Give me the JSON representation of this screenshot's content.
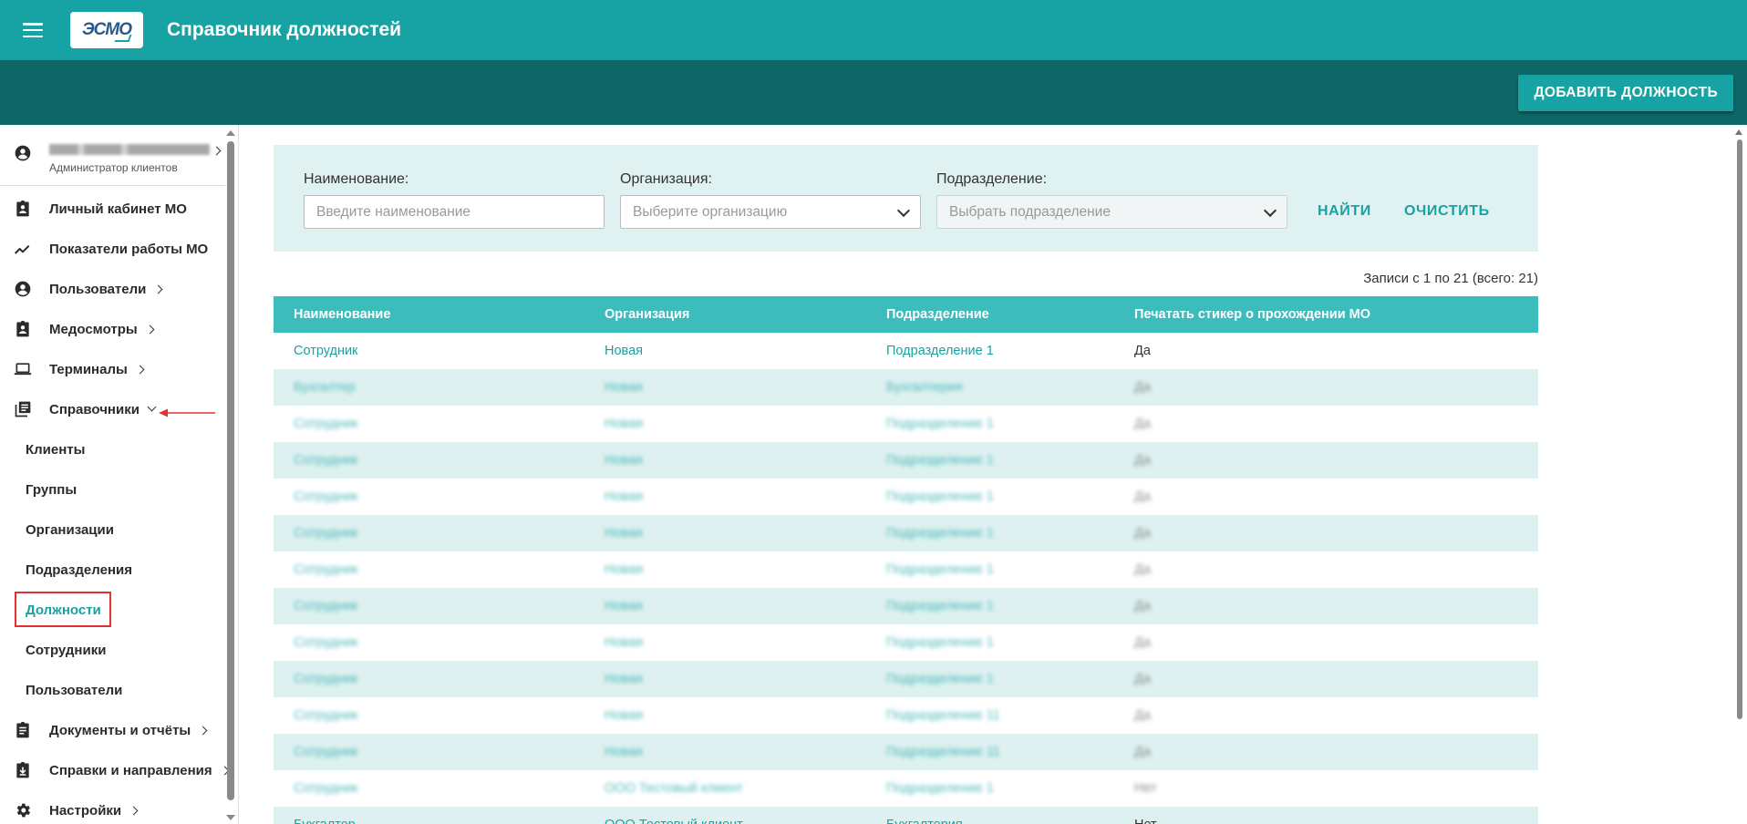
{
  "header": {
    "logo_text": "ЭСМО",
    "title": "Справочник должностей",
    "add_button": "ДОБАВИТЬ ДОЛЖНОСТЬ"
  },
  "sidebar": {
    "user": {
      "name": "Иванов Иван Иванович",
      "role": "Администратор клиентов"
    },
    "items": [
      {
        "label": "Личный кабинет МО",
        "icon": "clipboard-account-icon",
        "chevron": "none"
      },
      {
        "label": "Показатели работы МО",
        "icon": "trending-up-icon",
        "chevron": "none"
      },
      {
        "label": "Пользователи",
        "icon": "account-circle-icon",
        "chevron": "right"
      },
      {
        "label": "Медосмотры",
        "icon": "medical-clipboard-icon",
        "chevron": "right"
      },
      {
        "label": "Терминалы",
        "icon": "laptop-icon",
        "chevron": "right"
      },
      {
        "label": "Справочники",
        "icon": "library-books-icon",
        "chevron": "down"
      },
      {
        "label": "Документы и отчёты",
        "icon": "clipboard-text-icon",
        "chevron": "right"
      },
      {
        "label": "Справки и направления",
        "icon": "clipboard-download-icon",
        "chevron": "right"
      },
      {
        "label": "Настройки",
        "icon": "gear-icon",
        "chevron": "right"
      }
    ],
    "subitems": [
      {
        "label": "Клиенты"
      },
      {
        "label": "Группы"
      },
      {
        "label": "Организации"
      },
      {
        "label": "Подразделения"
      },
      {
        "label": "Должности",
        "active": true
      },
      {
        "label": "Сотрудники"
      },
      {
        "label": "Пользователи"
      }
    ],
    "accent_color": "#17a3a3",
    "highlight_color": "#e53030"
  },
  "filters": {
    "name_label": "Наименование:",
    "name_placeholder": "Введите наименование",
    "org_label": "Организация:",
    "org_placeholder": "Выберите организацию",
    "dept_label": "Подразделение:",
    "dept_placeholder": "Выбрать подразделение",
    "find_button": "НАЙТИ",
    "clear_button": "ОЧИСТИТЬ"
  },
  "records_info": "Записи с 1 по 21 (всего: 21)",
  "table": {
    "columns": [
      "Наименование",
      "Организация",
      "Подразделение",
      "Печатать стикер о прохождении МО"
    ],
    "rows": [
      {
        "name": "Сотрудник",
        "org": "Новая",
        "dept": "Подразделение 1",
        "print": "Да",
        "blurred": false
      },
      {
        "name": "Бухгалтер",
        "org": "Новая",
        "dept": "Бухгалтерия",
        "print": "Да",
        "blurred": true
      },
      {
        "name": "Сотрудник",
        "org": "Новая",
        "dept": "Подразделение 1",
        "print": "Да",
        "blurred": true
      },
      {
        "name": "Сотрудник",
        "org": "Новая",
        "dept": "Подразделение 1",
        "print": "Да",
        "blurred": true
      },
      {
        "name": "Сотрудник",
        "org": "Новая",
        "dept": "Подразделение 1",
        "print": "Да",
        "blurred": true
      },
      {
        "name": "Сотрудник",
        "org": "Новая",
        "dept": "Подразделение 1",
        "print": "Да",
        "blurred": true
      },
      {
        "name": "Сотрудник",
        "org": "Новая",
        "dept": "Подразделение 1",
        "print": "Да",
        "blurred": true
      },
      {
        "name": "Сотрудник",
        "org": "Новая",
        "dept": "Подразделение 1",
        "print": "Да",
        "blurred": true
      },
      {
        "name": "Сотрудник",
        "org": "Новая",
        "dept": "Подразделение 1",
        "print": "Да",
        "blurred": true
      },
      {
        "name": "Сотрудник",
        "org": "Новая",
        "dept": "Подразделение 1",
        "print": "Да",
        "blurred": true
      },
      {
        "name": "Сотрудник",
        "org": "Новая",
        "dept": "Подразделение 11",
        "print": "Да",
        "blurred": true
      },
      {
        "name": "Сотрудник",
        "org": "Новая",
        "dept": "Подразделение 11",
        "print": "Да",
        "blurred": true
      },
      {
        "name": "Сотрудник",
        "org": "ООО Тестовый клиент",
        "dept": "Подразделение 1",
        "print": "Нет",
        "blurred": true
      },
      {
        "name": "Бухгалтер",
        "org": "ООО Тестовый клиент",
        "dept": "Бухгалтерия",
        "print": "Нет",
        "blurred": false
      }
    ]
  }
}
